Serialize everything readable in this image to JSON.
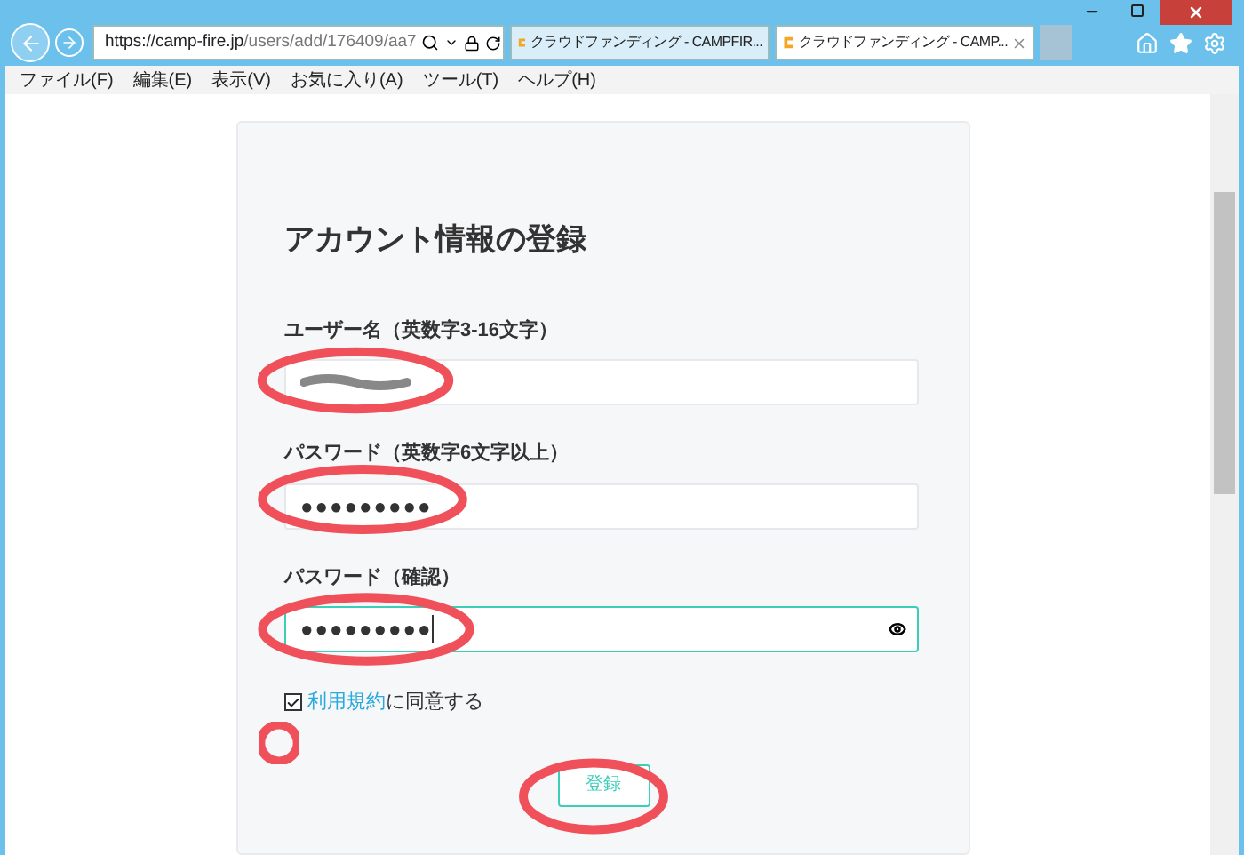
{
  "browser": {
    "address": {
      "host": "https://camp-fire.jp",
      "path": "/users/add/176409/aa7"
    },
    "tabs": [
      {
        "label": "クラウドファンディング - CAMPFIR...",
        "selected": false,
        "closable": false
      },
      {
        "label": "クラウドファンディング - CAMP...",
        "selected": true,
        "closable": true
      }
    ],
    "menu": [
      "ファイル(F)",
      "編集(E)",
      "表示(V)",
      "お気に入り(A)",
      "ツール(T)",
      "ヘルプ(H)"
    ]
  },
  "form": {
    "title": "アカウント情報の登録",
    "fields": [
      {
        "label": "ユーザー名（英数字3-16文字）",
        "kind": "scribbled",
        "focused": false
      },
      {
        "label": "パスワード（英数字6文字以上）",
        "kind": "password",
        "value": "●●●●●●●●●",
        "focused": false
      },
      {
        "label": "パスワード（確認）",
        "kind": "password",
        "value": "●●●●●●●●●",
        "focused": true
      }
    ],
    "agree": {
      "link": "利用規約",
      "text": "に同意する",
      "checked": true
    },
    "submit": "登録"
  }
}
